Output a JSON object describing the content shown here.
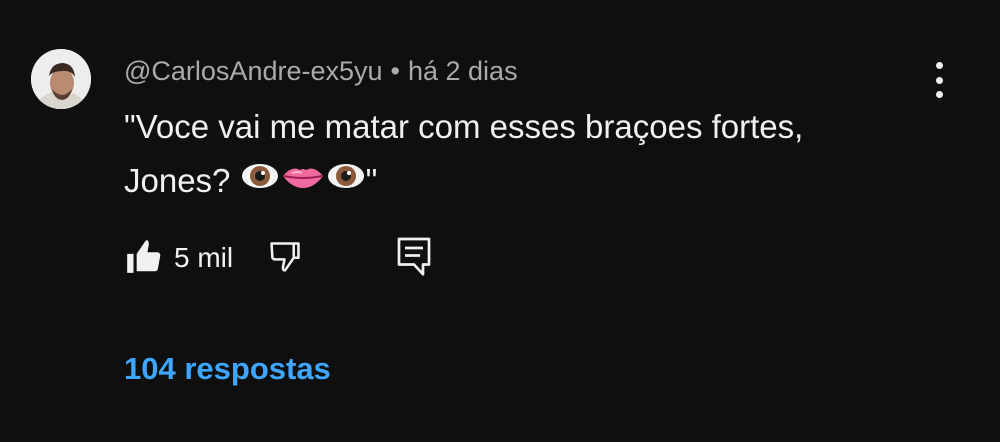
{
  "comment": {
    "author": "@CarlosAndre-ex5yu",
    "separator": "•",
    "time": "há 2 dias",
    "text_line1": "\"Voce vai me matar com esses braçoes fortes,",
    "text_line2_start": "Jones? ",
    "text_line2_end": "\"",
    "emojis": [
      "eye-emoji",
      "lips-emoji",
      "eye-emoji"
    ],
    "like_count": "5 mil",
    "replies_label": "104 respostas"
  },
  "colors": {
    "background": "#0f0f0f",
    "text": "#f1f1f1",
    "meta": "#aaaaaa",
    "link": "#3ea6ff"
  },
  "icons": {
    "like": "thumbs-up-icon",
    "dislike": "thumbs-down-icon",
    "reply": "reply-comment-icon",
    "more": "more-vertical-icon"
  }
}
